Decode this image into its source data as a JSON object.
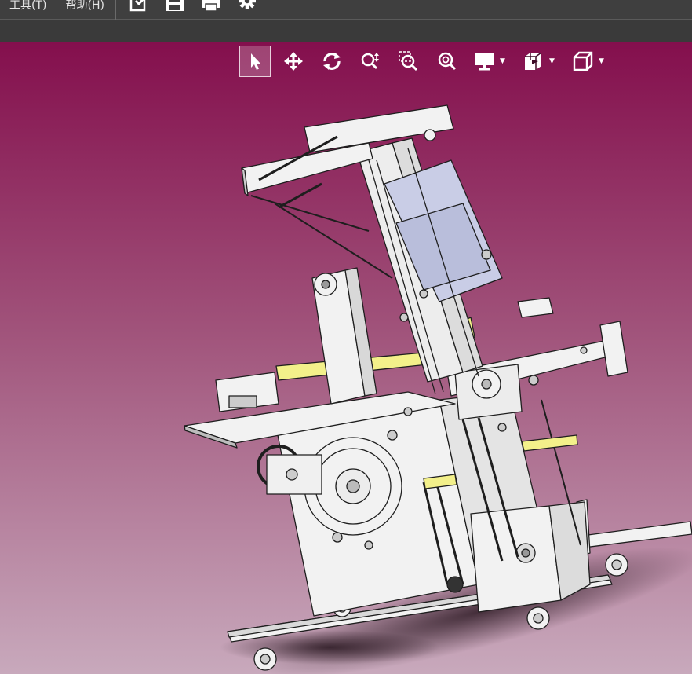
{
  "menu": {
    "items": [
      {
        "id": "tools",
        "label": "工具(T)"
      },
      {
        "id": "help",
        "label": "帮助(H)"
      }
    ]
  },
  "toolbar": {
    "icons": [
      "export-icon",
      "save-icon",
      "print-icon",
      "settings-icon"
    ]
  },
  "view_toolbar": {
    "tools": [
      {
        "name": "select-tool",
        "icon": "cursor-icon",
        "active": true
      },
      {
        "name": "pan-tool",
        "icon": "move-icon"
      },
      {
        "name": "rotate-tool",
        "icon": "rotate-icon"
      },
      {
        "name": "zoom-tool",
        "icon": "zoom-updown-icon"
      },
      {
        "name": "zoom-window-tool",
        "icon": "zoom-window-icon"
      },
      {
        "name": "zoom-fit-tool",
        "icon": "zoom-fit-icon"
      },
      {
        "name": "display-mode-dropdown",
        "icon": "monitor-icon"
      },
      {
        "name": "section-view-dropdown",
        "icon": "section-icon"
      },
      {
        "name": "view-orientation-dropdown",
        "icon": "cube-icon"
      }
    ]
  },
  "colors": {
    "viewport_top": "#840f4d",
    "viewport_bottom": "#c8a9bc",
    "menubar": "#3f3f3f",
    "model_white": "#f2f2f2",
    "model_blue": "#c9cde6",
    "model_yellow": "#f3f08a"
  }
}
